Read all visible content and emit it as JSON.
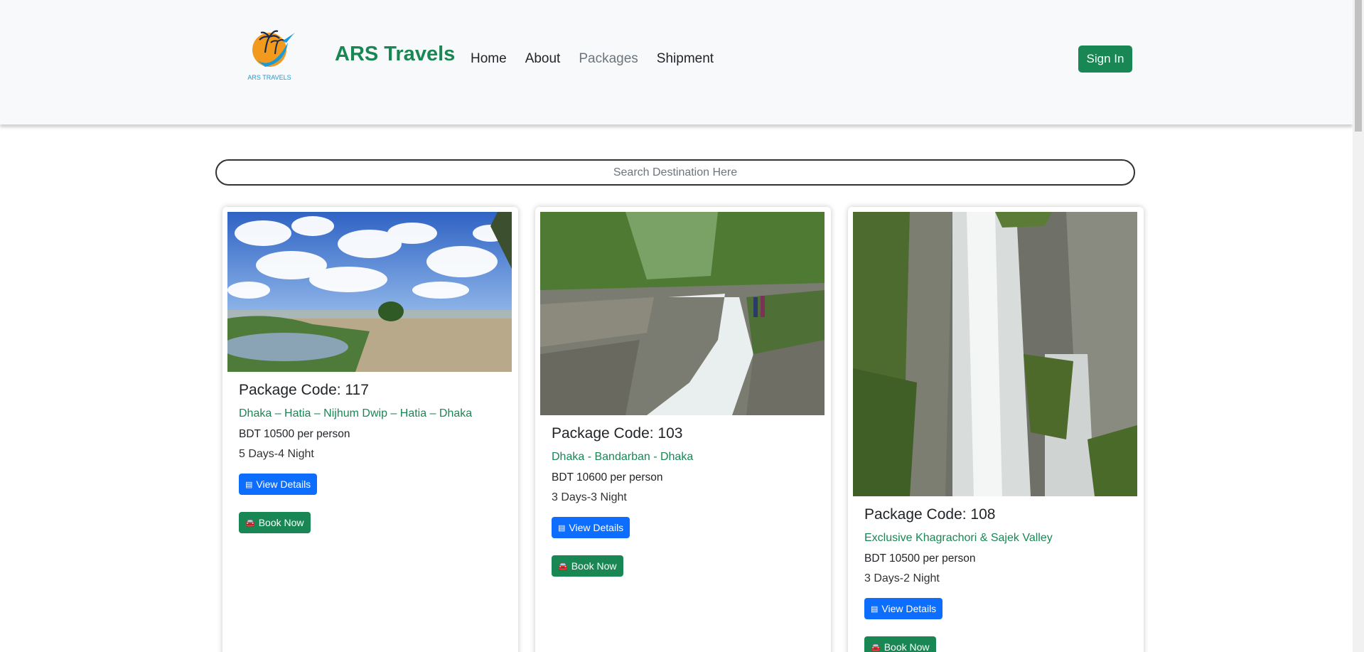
{
  "brand": {
    "name": "ARS Travels",
    "logo_text": "ARS TRAVELS"
  },
  "nav": {
    "items": [
      "Home",
      "About",
      "Packages",
      "Shipment"
    ],
    "active": "Packages"
  },
  "auth": {
    "signin_label": "Sign In"
  },
  "search": {
    "placeholder": "Search Destination Here"
  },
  "packages": [
    {
      "code": "Package Code: 117",
      "route": "Dhaka – Hatia – Nijhum Dwip – Hatia – Dhaka",
      "price": "BDT 10500 per person",
      "duration": "5 Days-4 Night",
      "image": "beach-clouds"
    },
    {
      "code": "Package Code: 103",
      "route": "Dhaka - Bandarban - Dhaka",
      "price": "BDT 10600 per person",
      "duration": "3 Days-3 Night",
      "image": "river-waterfall"
    },
    {
      "code": "Package Code: 108",
      "route": "Exclusive Khagrachori & Sajek Valley",
      "price": "BDT 10500 per person",
      "duration": "3 Days-2 Night",
      "image": "cliff-waterfall"
    }
  ],
  "buttons": {
    "details_label": "View Details",
    "book_label": "Book Now"
  },
  "icons": {
    "details": "list-icon",
    "book": "car-icon"
  },
  "colors": {
    "brand": "#198754",
    "primary": "#0d6efd",
    "header_bg": "#f8f9fa"
  }
}
